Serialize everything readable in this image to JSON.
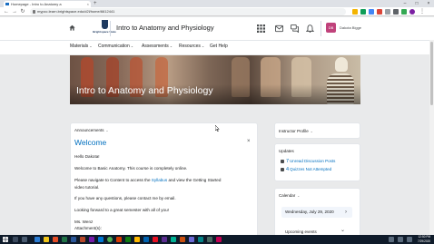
{
  "browser": {
    "tab_title": "Homepage - Intro to Anatomy a",
    "tab_close": "×",
    "new_tab": "+",
    "window_controls": [
      "–",
      "□",
      "×"
    ],
    "nav_buttons": [
      "←",
      "→",
      "↻"
    ],
    "url": "mypcc.learn.brightspace.edu/d2l/home/6612441"
  },
  "header": {
    "logo_text": "Brightspace State",
    "course_title": "Intro to Anatomy and Physiology",
    "user_initials": "DB",
    "user_name": "Dakota Bigge"
  },
  "nav": {
    "items": [
      {
        "label": "Materials",
        "has_menu": true
      },
      {
        "label": "Communication",
        "has_menu": true
      },
      {
        "label": "Assessments",
        "has_menu": true
      },
      {
        "label": "Resources",
        "has_menu": true
      },
      {
        "label": "Get Help",
        "has_menu": false
      }
    ],
    "chevron": "⌄"
  },
  "banner": {
    "title": "Intro to Anatomy and Physiology"
  },
  "announcements": {
    "heading": "Announcements",
    "chevron": "⌄",
    "title": "Welcome",
    "close": "×",
    "greeting": "Hello Dakota!",
    "line1": "Welcome to Basic Anatomy.  This course is completely online.",
    "line2_pre": "Please navigate to Content to access the ",
    "line2_link": "Syllabus",
    "line2_post": " and view the Getting Started",
    "line3": "video tutorial.",
    "line4": "If you have any questions, please contact me by email.",
    "line5": "Looking forward to a great semester with all of you!",
    "signature": "Ms. Wenz",
    "attachments": "Attachment(s):"
  },
  "instructor_profile": {
    "heading": "Instructor Profile",
    "chevron": "⌄"
  },
  "updates": {
    "heading": "Updates",
    "items": [
      {
        "count": "7",
        "label": "Unread Discussion Posts"
      },
      {
        "count": "4",
        "label": "Quizzes Not Attempted"
      }
    ]
  },
  "calendar": {
    "heading": "Calendar",
    "chevron": "⌄",
    "date": "Wednesday, July 29, 2020",
    "date_chevron": "›",
    "upcoming": "Upcoming events",
    "upcoming_chevron": "⌄"
  },
  "taskbar": {
    "time": "12:50 PM",
    "date": "7/29/2020"
  },
  "colors": {
    "link": "#006fbf",
    "avatar": "#c0427b",
    "taskbar": "#0f1b2a",
    "logo": "#1f3a60"
  }
}
